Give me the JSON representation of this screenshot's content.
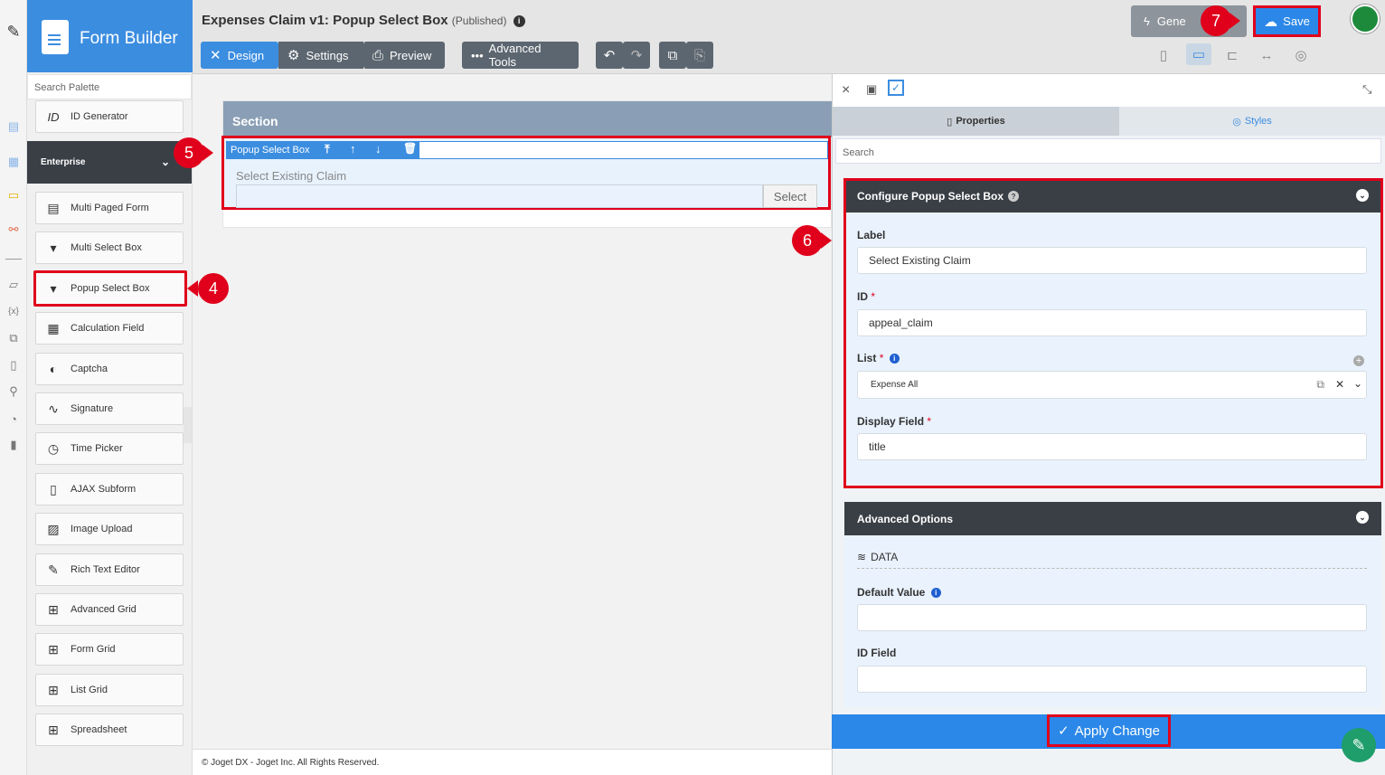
{
  "app": {
    "builder_title": "Form Builder",
    "form_title": "Expenses Claim v1: Popup Select Box",
    "status": "(Published)"
  },
  "toolbar": {
    "design_label": "Design",
    "settings_label": "Settings",
    "preview_label": "Preview",
    "advanced_tools_label": "Advanced Tools",
    "generate_label": "Gene",
    "save_label": "Save"
  },
  "palette": {
    "search_placeholder": "Search Palette",
    "top_item": "ID Generator",
    "category": "Enterprise",
    "items": [
      {
        "label": "Multi Paged Form",
        "icon": "multi-page-icon"
      },
      {
        "label": "Multi Select Box",
        "icon": "select-box-icon"
      },
      {
        "label": "Popup Select Box",
        "icon": "select-box-icon"
      },
      {
        "label": "Calculation Field",
        "icon": "calculator-icon"
      },
      {
        "label": "Captcha",
        "icon": "shield-icon"
      },
      {
        "label": "Signature",
        "icon": "signature-icon"
      },
      {
        "label": "Time Picker",
        "icon": "clock-icon"
      },
      {
        "label": "AJAX Subform",
        "icon": "document-icon"
      },
      {
        "label": "Image Upload",
        "icon": "image-icon"
      },
      {
        "label": "Rich Text Editor",
        "icon": "edit-icon"
      },
      {
        "label": "Advanced Grid",
        "icon": "grid-icon"
      },
      {
        "label": "Form Grid",
        "icon": "grid-icon"
      },
      {
        "label": "List Grid",
        "icon": "grid-icon"
      },
      {
        "label": "Spreadsheet",
        "icon": "grid-icon"
      }
    ]
  },
  "canvas": {
    "section_title": "Section",
    "element_type": "Popup Select Box",
    "field_label": "Select Existing Claim",
    "select_button": "Select",
    "footer": "© Joget DX - Joget Inc. All Rights Reserved."
  },
  "properties": {
    "tab_properties": "Properties",
    "tab_styles": "Styles",
    "search_placeholder": "Search",
    "configure_title": "Configure Popup Select Box",
    "label_label": "Label",
    "label_value": "Select Existing Claim",
    "id_label": "ID",
    "id_value": "appeal_claim",
    "list_label": "List",
    "list_value": "Expense All",
    "display_field_label": "Display Field",
    "display_field_value": "title",
    "advanced_title": "Advanced Options",
    "data_heading": "DATA",
    "default_value_label": "Default Value",
    "default_value": "",
    "id_field_label": "ID Field",
    "id_field_value": "",
    "apply_label": "Apply Change"
  },
  "callouts": [
    "4",
    "5",
    "6",
    "7"
  ],
  "colors": {
    "accent": "#3b8de0",
    "dark_header": "#3a3f46",
    "highlight": "#e0001b"
  }
}
